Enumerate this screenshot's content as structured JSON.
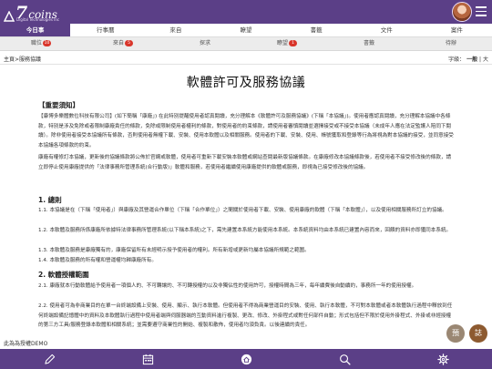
{
  "brand": {
    "logo_number": "7",
    "logo_word": "coins",
    "logo_sub": "Digital Technologies Inc"
  },
  "tabs_primary": [
    "今日事",
    "行事曆",
    "來自",
    "瞭望",
    "書籤",
    "文件",
    "案件"
  ],
  "tabs_secondary": [
    {
      "label": "職位",
      "badge": "10"
    },
    {
      "label": "來自",
      "badge": "5"
    },
    {
      "label": "探求",
      "badge": ""
    },
    {
      "label": "瞭望",
      "badge": "1"
    },
    {
      "label": "書籤",
      "badge": ""
    },
    {
      "label": "待辦",
      "badge": ""
    }
  ],
  "breadcrumb": "主頁>服務協議",
  "font_size": {
    "label": "字級：",
    "current": "一般",
    "separator": "|",
    "other": "大"
  },
  "document": {
    "title": "軟體許可及服務協議",
    "notice_heading": "【重要須知】",
    "notice_p1": "【康博多樂體數位科技有限公司】(如下簡稱「康廠」) 在此特別提醒使用者認真閱讀，充分理解本《軟體許可及服務協議》(下稱「本協議」)。使用者應認真閱讀，充分理解本協議中各條款，特別是涉及免除或者限制康廠責任的條款，免除或限制使用者權利的條款，對使用者的約束條款，請使用者審慎閱讀並選擇接受或不接受本協議（未成年人應在法定監護人陪同下閱讀）。除非使用者接受本協議所有條款，否則使用者無權下載、安裝、使用本軟體以及相關服務。使用者的下載、安裝、使用、帳號獲取和登錄等行為將視為對本協議的接受，並同意接受本協議各項條款的約束。",
    "notice_p2": "康廠有權修訂本協議，更新後的協議條款將公佈於官網或軟體，使用者可重新下載安裝本軟體或網站查閱最新版協議條款。在康廠修改本協議條款後，若使用者不接受修改後的條款，請立即停止使用康廠提供的「法律事務所管理系統(合行動版)」軟體和服務，若使用者繼續使用康廠提供的軟體或服務，即視為已接受修改後的協議。",
    "sec1_heading": "1. 總則",
    "sec1_p1": "1.1. 本協議是在（下稱「使用者」）與康廠及其營運合作單位（下稱「合作單位」）之間關於使用者下載、安裝、使用康廠的軟體（下稱「本軟體」），以及使用相關服務所訂立的協議。",
    "sec1_p2": "1.2. 本軟體及服務所係康廠所依據特法律事務所管理系統(以下稱本系統)之下，需先建置本系統方能使用本系統。本系統資料均由本系統已建置內容而來，回饋的資料亦即獲同本系統。",
    "sec1_p3": "1.3. 本軟體及服務是康廠獨有的，康廠保留所有未經明示授予使用者的權利。所有新增或更新均屬本協議所規範之範圍。",
    "sec1_p4": "1.4. 本軟體及服務的所有權和營運權均歸康廠所有。",
    "sec2_heading": "2. 軟體授權範圍",
    "sec2_p1": "2.1. 康廠就本行動軟體給予使用者一項個人的、不可轉讓的、不可轉授權的以及非獨佔性的使用許可，授權時間為三年，每年續費後自動續約，事務所一年的使用授權。",
    "sec2_p2": "2.2. 使用者可為非商業目的在單一台終端設備上安裝、使用、顯示、執行本軟體。但使用者不得為商業營運目的安裝、使用、執行本軟體，不可對本軟體或者本軟體執行過程中釋放到任何終端設備記憶體中的資料及本軟體執行過程中使用者端與伺服器端的互動資料進行複製、更改、修改、外掛程式或對任何部件自動；形式包括但不限於使用外掛程式、外掛或非經授權的第三方工具/服務登錄本軟體和相關系統；並需要遵守商業性的開始、複製和散佈，使用者均須負責。以後連續的責任。"
  },
  "demo_label": "此為為授權DEMO",
  "fab_buttons": [
    "預",
    "誌"
  ],
  "bottom_nav": [
    "pen-icon",
    "calendar-icon",
    "home-icon",
    "search-icon",
    "settings-icon"
  ]
}
